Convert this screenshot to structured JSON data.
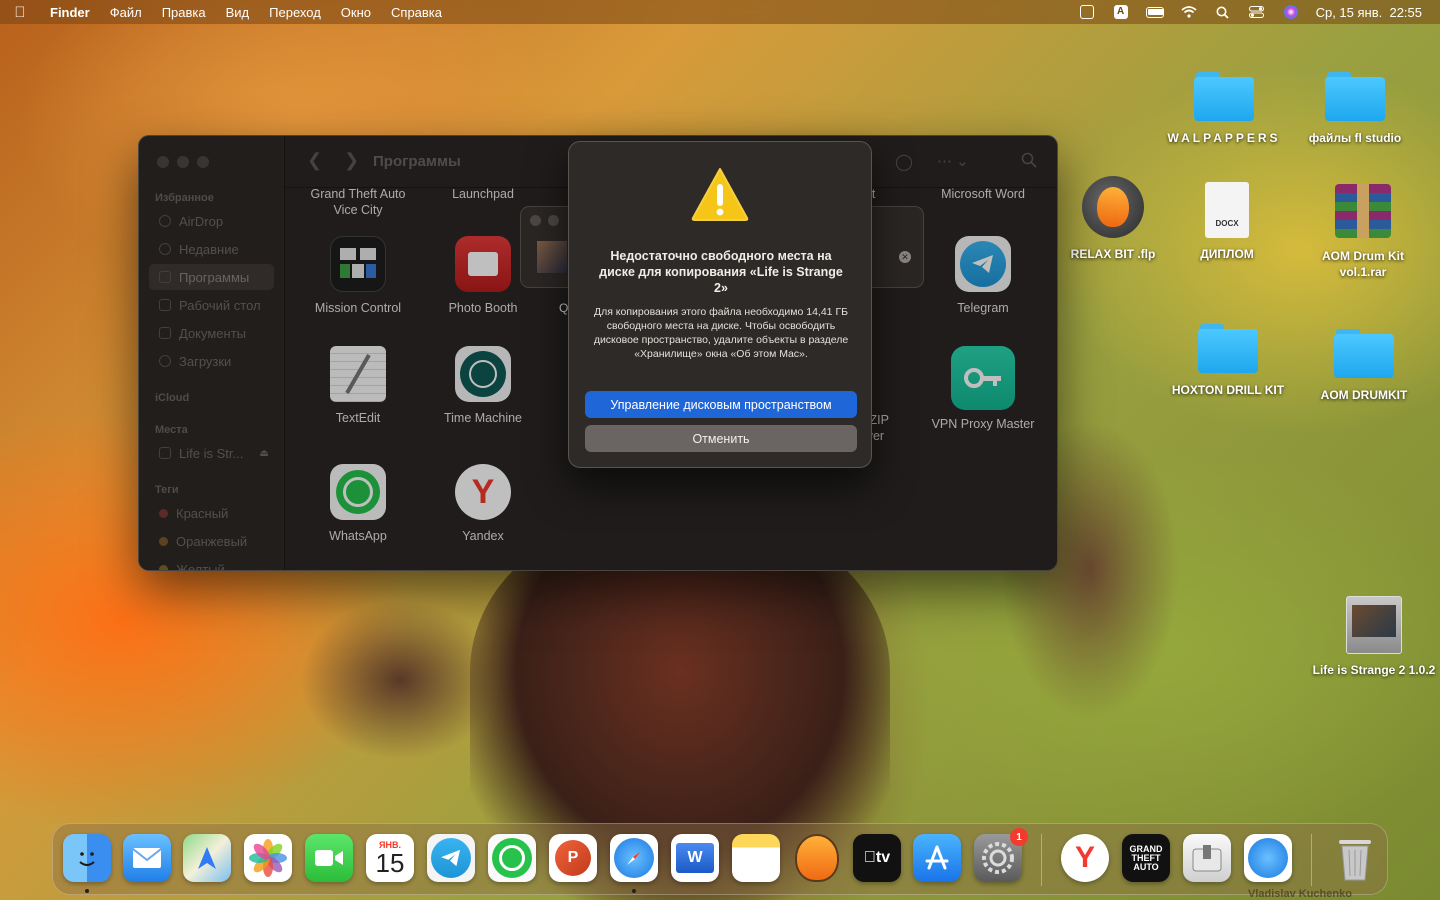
{
  "menubar": {
    "apple": "",
    "items": [
      "Finder",
      "Файл",
      "Правка",
      "Вид",
      "Переход",
      "Окно",
      "Справка"
    ],
    "input_source": "A",
    "clock": "Ср, 15 янв.  22:55"
  },
  "finder": {
    "title": "Программы",
    "sidebar": {
      "favorites_header": "Избранное",
      "favorites": [
        "AirDrop",
        "Недавние",
        "Программы",
        "Рабочий стол",
        "Документы",
        "Загрузки"
      ],
      "icloud_header": "iCloud",
      "places_header": "Места",
      "places": [
        "Life is Str..."
      ],
      "tags_header": "Теги",
      "tags": [
        {
          "label": "Красный",
          "color": "#d9534f"
        },
        {
          "label": "Оранжевый",
          "color": "#e8952f"
        },
        {
          "label": "Желтый",
          "color": "#e8c62f"
        }
      ]
    },
    "apps": {
      "row0": [
        "Grand Theft Auto\nVice City",
        "Launchpad",
        "...oft",
        "Microsoft Word"
      ],
      "mission_control": "Mission Control",
      "photo_booth": "Photo Booth",
      "telegram": "Telegram",
      "textedit": "TextEdit",
      "time_machine": "Time Machine",
      "zip_partial": "R ZIP\nhiver",
      "vpn": "VPN Proxy Master",
      "whatsapp": "WhatsApp",
      "yandex": "Yandex",
      "partial_q": "Q"
    }
  },
  "dialog": {
    "title": "Недостаточно свободного места на диске для копирования «Life is Strange 2»",
    "message": "Для копирования этого файла необходимо 14,41 ГБ свободного места на диске. Чтобы освободить дисковое пространство, удалите объекты в разделе «Хранилище» окна «Об этом Mac».",
    "primary_button": "Управление дисковым пространством",
    "cancel_button": "Отменить"
  },
  "desktop": {
    "walpappers": "WALPAPPERS",
    "fl_studio": "файлы fl studio",
    "relax_bit": "RELAX BIT .flp",
    "diplom": "ДИПЛОМ",
    "diplom_ext": "DOCX",
    "aom_drum_kit": "AOM Drum Kit vol.1.rar",
    "hoxton": "HOXTON DRILL KIT",
    "aom_drumkit": "AOM DRUMKIT",
    "life_is_strange": "Life is Strange 2 1.0.2"
  },
  "dock": {
    "calendar_month": "ЯНВ.",
    "calendar_day": "15",
    "appletv": "tv",
    "settings_badge": "1",
    "watermark": "Vladislav Kuchenko"
  },
  "colors": {
    "accent": "#1f66d9",
    "folder": "#2bb3f5",
    "warning": "#f5c518"
  }
}
